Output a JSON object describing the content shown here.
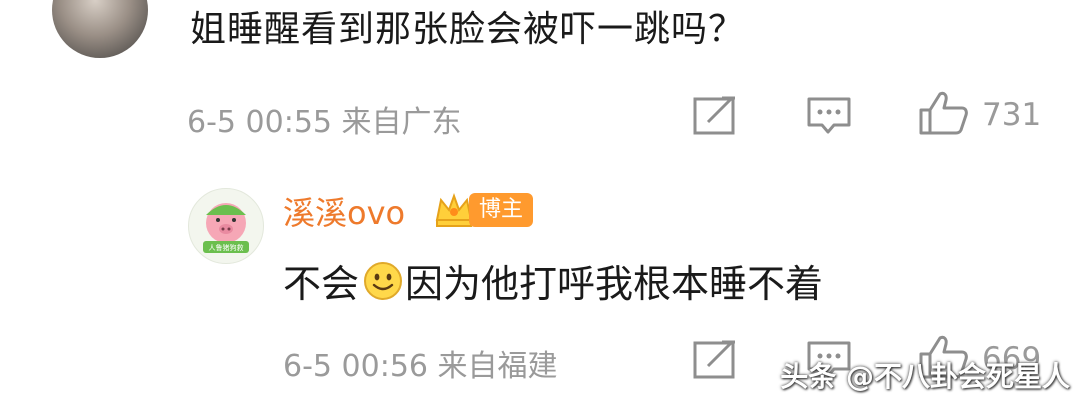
{
  "top_comment": {
    "text": "姐睡醒看到那张脸会被吓一跳吗？",
    "meta": "6-5 00:55 来自广东",
    "like_count": "731"
  },
  "reply": {
    "username": "溪溪ovo",
    "badge": "博主",
    "text_before": "不会",
    "text_after": "因为他打呼我根本睡不着",
    "meta": "6-5 00:56 来自福建",
    "like_count": "669",
    "avatar_caption": "人鲁猪狗救"
  },
  "watermark": "头条 @不八卦会死星人",
  "colors": {
    "name": "#ee7a2c",
    "badge": "#ff9a2e",
    "meta": "#9a9a9a"
  },
  "icons": [
    "share-icon",
    "comment-icon",
    "like-icon",
    "smile-emoji-icon",
    "crown-icon"
  ]
}
